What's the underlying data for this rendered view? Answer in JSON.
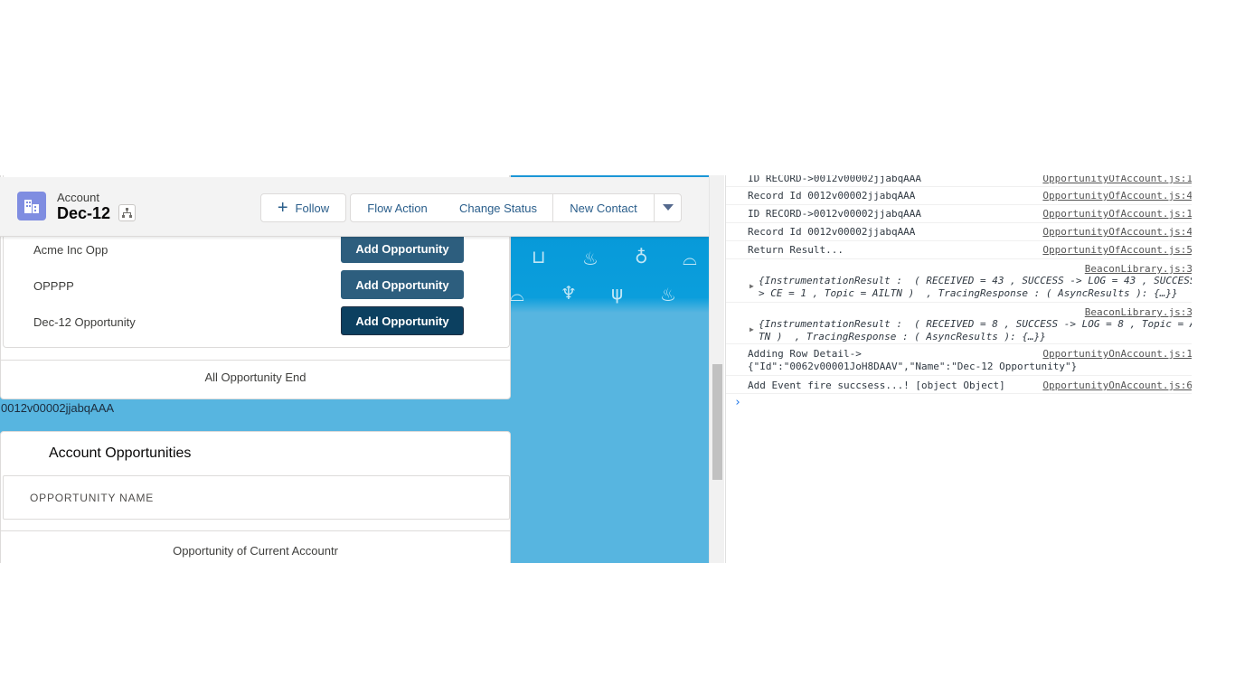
{
  "header": {
    "object_label": "Account",
    "record_name": "Dec-12",
    "buttons": {
      "follow": "Follow",
      "flow_action": "Flow Action",
      "change_status": "Change Status",
      "new_contact": "New Contact"
    }
  },
  "opportunities_card": {
    "rows": [
      {
        "name": "Acme Inc Opp",
        "button": "Add Opportunity"
      },
      {
        "name": "OPPPP",
        "button": "Add Opportunity"
      },
      {
        "name": "Dec-12 Opportunity",
        "button": "Add Opportunity"
      }
    ],
    "footer": "All Opportunity End"
  },
  "record_id": "0012v00002jjabqAAA",
  "account_opportunities": {
    "title": "Account Opportunities",
    "column_header": "OPPORTUNITY NAME",
    "footer": "Opportunity of Current Accountr"
  },
  "console": {
    "lines": [
      {
        "msg": "ID RECORD->0012v00002jjabqAAA",
        "src": "OpportunityOfAccount.js:1"
      },
      {
        "msg": "Record Id 0012v00002jjabqAAA",
        "src": "OpportunityOfAccount.js:4"
      },
      {
        "msg": "ID RECORD->0012v00002jjabqAAA",
        "src": "OpportunityOfAccount.js:1"
      },
      {
        "msg": "Record Id 0012v00002jjabqAAA",
        "src": "OpportunityOfAccount.js:4"
      },
      {
        "msg": "Return Result...",
        "src": "OpportunityOfAccount.js:5"
      }
    ],
    "beacon1": {
      "src": "BeaconLibrary.js:3",
      "line1": "{InstrumentationResult :  ( RECEIVED = 43 , SUCCESS -> LOG = 43 , SUCCESS",
      "line2": "> CE = 1 , Topic = AILTN )  , TracingResponse : ( AsyncResults ): {…}}"
    },
    "beacon2": {
      "src": "BeaconLibrary.js:3",
      "line1": "{InstrumentationResult :  ( RECEIVED = 8 , SUCCESS -> LOG = 8 , Topic = A",
      "line2": "TN )  , TracingResponse : ( AsyncResults ): {…}}"
    },
    "row_detail": {
      "line1": "Adding Row Detail->",
      "line2": "{\"Id\":\"0062v00001JoH8DAAV\",\"Name\":\"Dec-12 Opportunity\"}",
      "src": "OpportunityOnAccount.js:1"
    },
    "event": {
      "msg": "Add Event fire succsess...! [object Object]",
      "src": "OpportunityOnAccount.js:6"
    },
    "prompt": "›"
  },
  "icons": [
    "account-icon",
    "hierarchy-icon",
    "plus-icon",
    "chevron-down-icon"
  ]
}
